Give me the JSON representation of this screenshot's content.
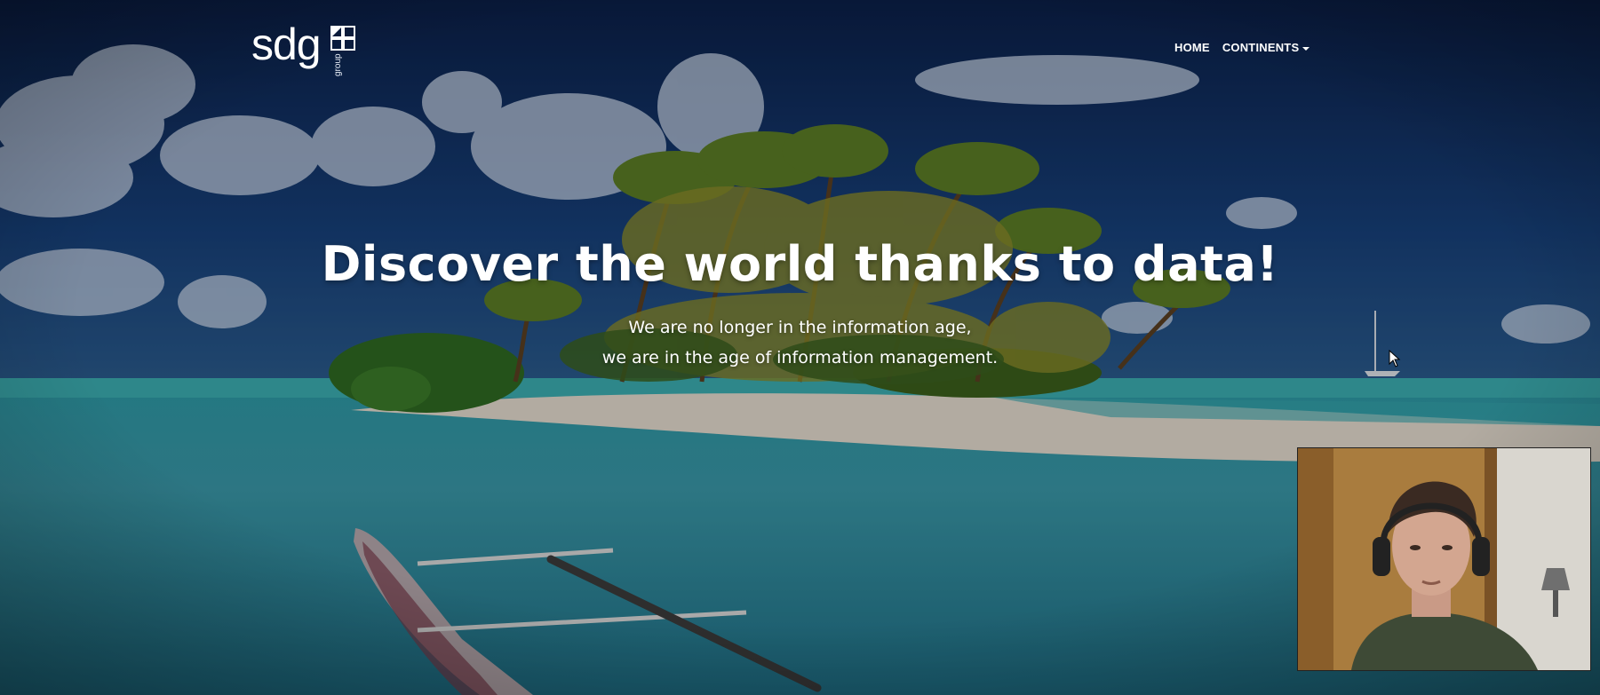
{
  "brand": {
    "logo_text": "sdg",
    "logo_subtext": "group"
  },
  "nav": {
    "items": [
      {
        "label": "HOME"
      },
      {
        "label": "CONTINENTS"
      }
    ]
  },
  "hero": {
    "headline": "Discover the world thanks to data!",
    "subline_1": "We are no longer in the information age,",
    "subline_2": "we are in the age of information management."
  },
  "icons": [
    "logo-grid-icon",
    "dropdown-caret-icon",
    "mouse-cursor-icon"
  ],
  "colors": {
    "sky": "#0f2a5c",
    "sea": "#2a8fa0",
    "sand": "#e6dfd3",
    "text": "#ffffff"
  }
}
